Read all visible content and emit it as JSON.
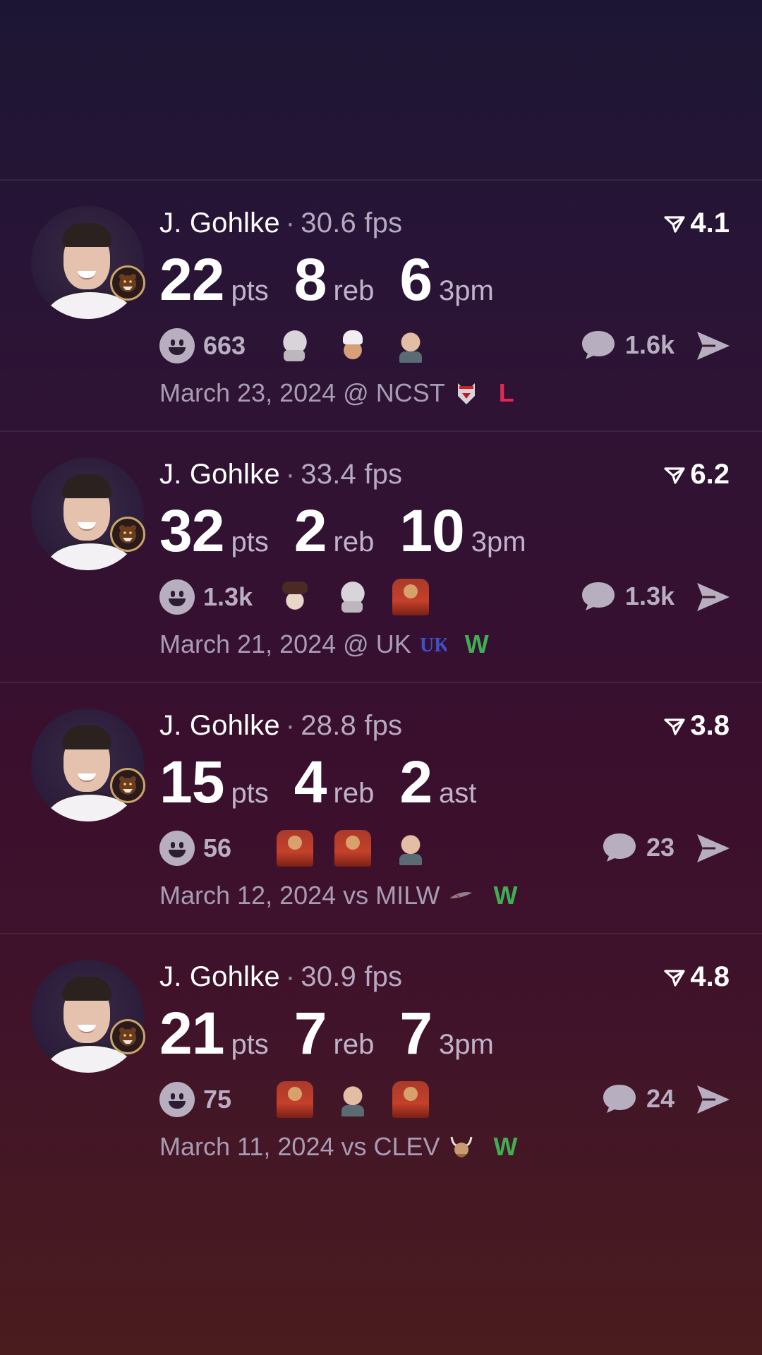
{
  "cards": [
    {
      "name": "J. Gohlke",
      "fps": "30.6 fps",
      "rating": "4.1",
      "stats": [
        {
          "num": "22",
          "unit": "pts"
        },
        {
          "num": "8",
          "unit": "reb"
        },
        {
          "num": "6",
          "unit": "3pm"
        }
      ],
      "reactions_count": "663",
      "reaction_emojis": [
        "goat",
        "chef",
        "baby"
      ],
      "comments_count": "1.6k",
      "date_line": "March 23, 2024 @ NCST",
      "opponent_logo": "wolf-logo",
      "result": "L"
    },
    {
      "name": "J. Gohlke",
      "fps": "33.4 fps",
      "rating": "6.2",
      "stats": [
        {
          "num": "32",
          "unit": "pts"
        },
        {
          "num": "2",
          "unit": "reb"
        },
        {
          "num": "10",
          "unit": "3pm"
        }
      ],
      "reactions_count": "1.3k",
      "reaction_emojis": [
        "hands",
        "goat",
        "fire"
      ],
      "comments_count": "1.3k",
      "date_line": "March 21, 2024 @ UK",
      "opponent_logo": "uk-logo",
      "result": "W"
    },
    {
      "name": "J. Gohlke",
      "fps": "28.8 fps",
      "rating": "3.8",
      "stats": [
        {
          "num": "15",
          "unit": "pts"
        },
        {
          "num": "4",
          "unit": "reb"
        },
        {
          "num": "2",
          "unit": "ast"
        }
      ],
      "reactions_count": "56",
      "reaction_emojis": [
        "fire",
        "fire",
        "baby"
      ],
      "comments_count": "23",
      "date_line": "March 12, 2024 vs MILW",
      "opponent_logo": "feather-logo",
      "result": "W"
    },
    {
      "name": "J. Gohlke",
      "fps": "30.9 fps",
      "rating": "4.8",
      "stats": [
        {
          "num": "21",
          "unit": "pts"
        },
        {
          "num": "7",
          "unit": "reb"
        },
        {
          "num": "7",
          "unit": "3pm"
        }
      ],
      "reactions_count": "75",
      "reaction_emojis": [
        "fire",
        "baby",
        "fire"
      ],
      "comments_count": "24",
      "date_line": "March 11, 2024 vs CLEV",
      "opponent_logo": "viking-logo",
      "result": "W"
    }
  ],
  "colors": {
    "loss": "#e02a56",
    "win": "#3fae55",
    "badge_ring": "#c9a46a"
  }
}
